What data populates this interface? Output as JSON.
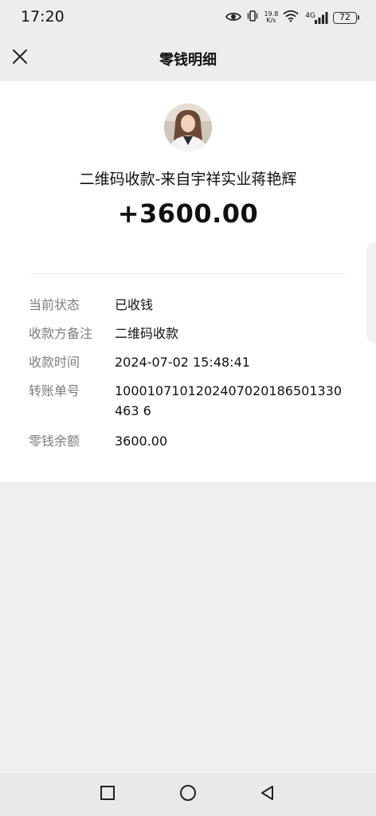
{
  "status_bar": {
    "time": "17:20",
    "net_speed_value": "19.8",
    "net_speed_unit": "K/s",
    "network_type": "4G",
    "battery": "72",
    "icons": [
      "eye-icon",
      "vibrate-icon",
      "wifi-icon",
      "signal-icon",
      "battery-icon"
    ]
  },
  "header": {
    "title": "零钱明细",
    "close_icon": "close-icon"
  },
  "transaction": {
    "payer_title": "二维码收款-来自宇祥实业蒋艳辉",
    "amount": "+3600.00",
    "details": [
      {
        "label": "当前状态",
        "value": "已收钱"
      },
      {
        "label": "收款方备注",
        "value": "二维码收款"
      },
      {
        "label": "收款时间",
        "value": "2024-07-02 15:48:41"
      },
      {
        "label": "转账单号",
        "value": "1000107101202407020186501330463 6"
      },
      {
        "label": "零钱余额",
        "value": "3600.00"
      }
    ]
  },
  "nav_bar": {
    "icons": [
      "recent-apps-icon",
      "home-icon",
      "back-icon"
    ]
  }
}
